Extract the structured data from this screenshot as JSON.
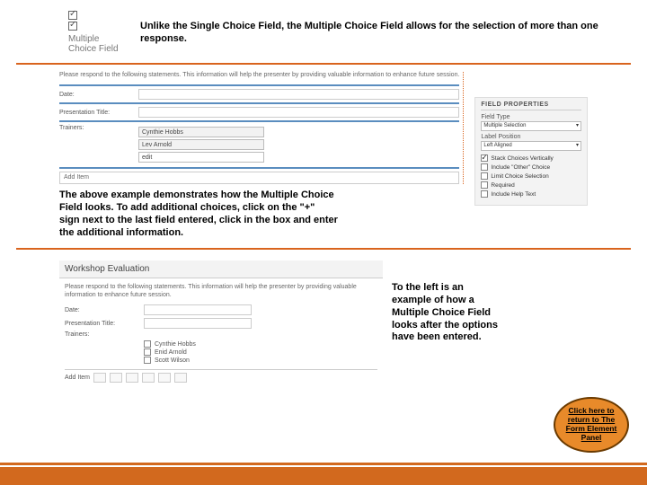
{
  "header": {
    "icon_label_line1": "Multiple",
    "icon_label_line2": "Choice Field",
    "intro": "Unlike the Single Choice Field, the Multiple Choice Field allows for the selection of more than one response."
  },
  "example1": {
    "form_note": "Please respond to the following statements. This information will help the presenter by providing valuable information to enhance future session.",
    "fields": {
      "date": "Date:",
      "presentation": "Presentation Title:",
      "trainers": "Trainers:"
    },
    "trainer_opts": [
      "Cynthie Hobbs",
      "Lev Arnold",
      "edit"
    ],
    "add_item": "Add Item",
    "caption": "The above example demonstrates how the Multiple Choice Field looks. To add additional choices, click on the \"+\" sign next to the last field entered, click in the box and enter the additional information."
  },
  "properties": {
    "header": "FIELD PROPERTIES",
    "field_type_label": "Field Type",
    "field_type_value": "Multiple Selection",
    "label_pos_label": "Label Position",
    "label_pos_value": "Left Aligned",
    "checks": [
      {
        "label": "Stack Choices Vertically",
        "on": true
      },
      {
        "label": "Include \"Other\" Choice",
        "on": false
      },
      {
        "label": "Limit Choice Selection",
        "on": false
      },
      {
        "label": "Required",
        "on": false
      },
      {
        "label": "Include Help Text",
        "on": false
      }
    ]
  },
  "example2": {
    "title": "Workshop Evaluation",
    "form_note": "Please respond to the following statements. This information will help the presenter by providing valuable information to enhance future session.",
    "fields": {
      "date": "Date:",
      "presentation": "Presentation Title:",
      "trainers": "Trainers:"
    },
    "trainer_opts": [
      "Cynthie Hobbs",
      "Enid Arnold",
      "Scott Wilson"
    ],
    "add_item": "Add Item",
    "caption": "To the left is an example of how a Multiple Choice Field looks after the options have been entered."
  },
  "return_link": "Click here to return to The Form Element Panel"
}
